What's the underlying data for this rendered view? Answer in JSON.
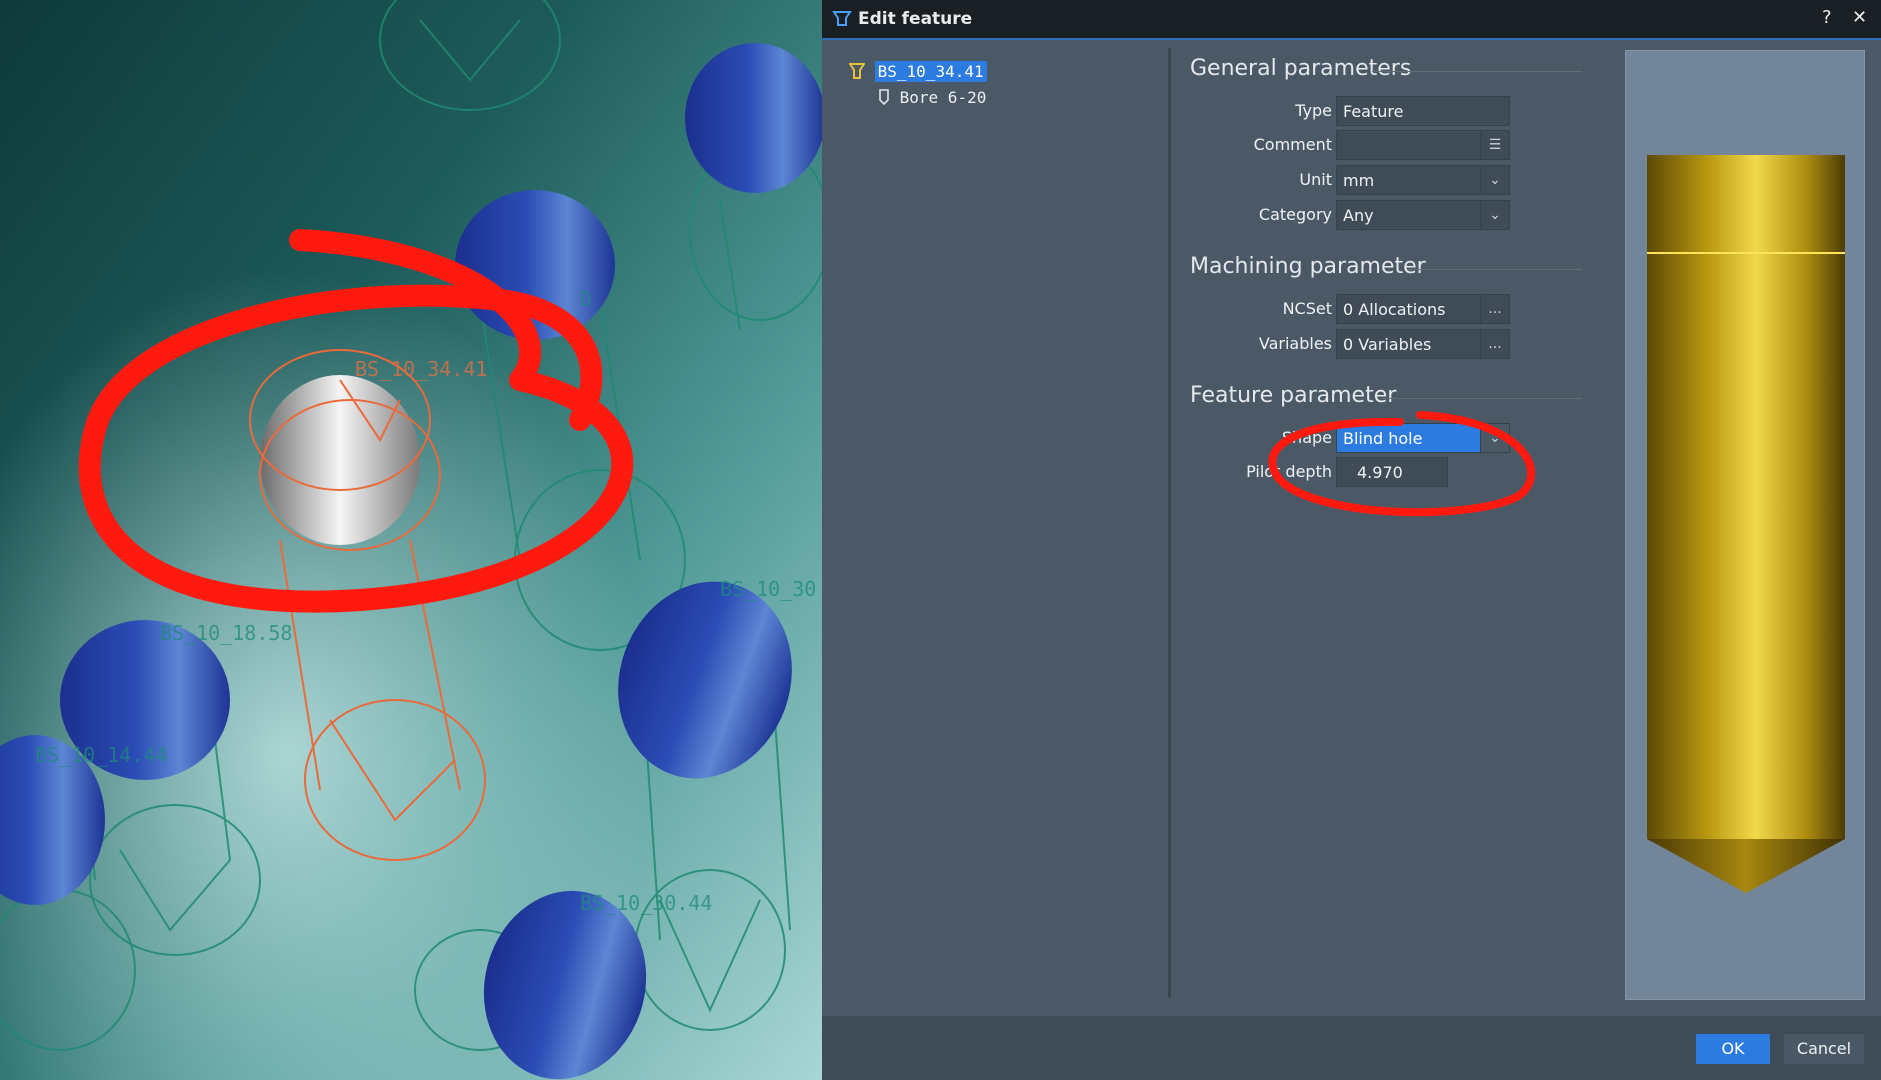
{
  "viewport": {
    "labels": [
      "BS_10_34.41",
      "BS_10_18.58",
      "BS_10_14.44",
      "BS_10_30",
      "BS_10_30.44",
      "D"
    ]
  },
  "dialog": {
    "title": "Edit feature",
    "help": "?",
    "close": "✕",
    "tree": {
      "root": "BS_10_34.41",
      "child": "Bore 6-20"
    },
    "general": {
      "title": "General parameters",
      "type_label": "Type",
      "type_value": "Feature",
      "comment_label": "Comment",
      "comment_value": "",
      "unit_label": "Unit",
      "unit_value": "mm",
      "category_label": "Category",
      "category_value": "Any"
    },
    "machining": {
      "title": "Machining parameter",
      "ncset_label": "NCSet",
      "ncset_value": "0 Allocations",
      "variables_label": "Variables",
      "variables_value": "0 Variables"
    },
    "feature": {
      "title": "Feature parameter",
      "shape_label": "Shape",
      "shape_value": "Blind hole",
      "pilot_label": "Pilot depth",
      "pilot_value": "4.970"
    },
    "more": "...",
    "ok": "OK",
    "cancel": "Cancel"
  },
  "colors": {
    "accent": "#2b7be0",
    "annotation": "#ff1a10",
    "dialog_bg": "#4b5966",
    "tool_gold": "#d4b21c"
  },
  "icons": [
    "feature-icon",
    "bore-icon",
    "comment-menu-icon",
    "chevron-down-icon",
    "ellipsis-icon",
    "scroll-left-icon",
    "scroll-right-icon"
  ]
}
